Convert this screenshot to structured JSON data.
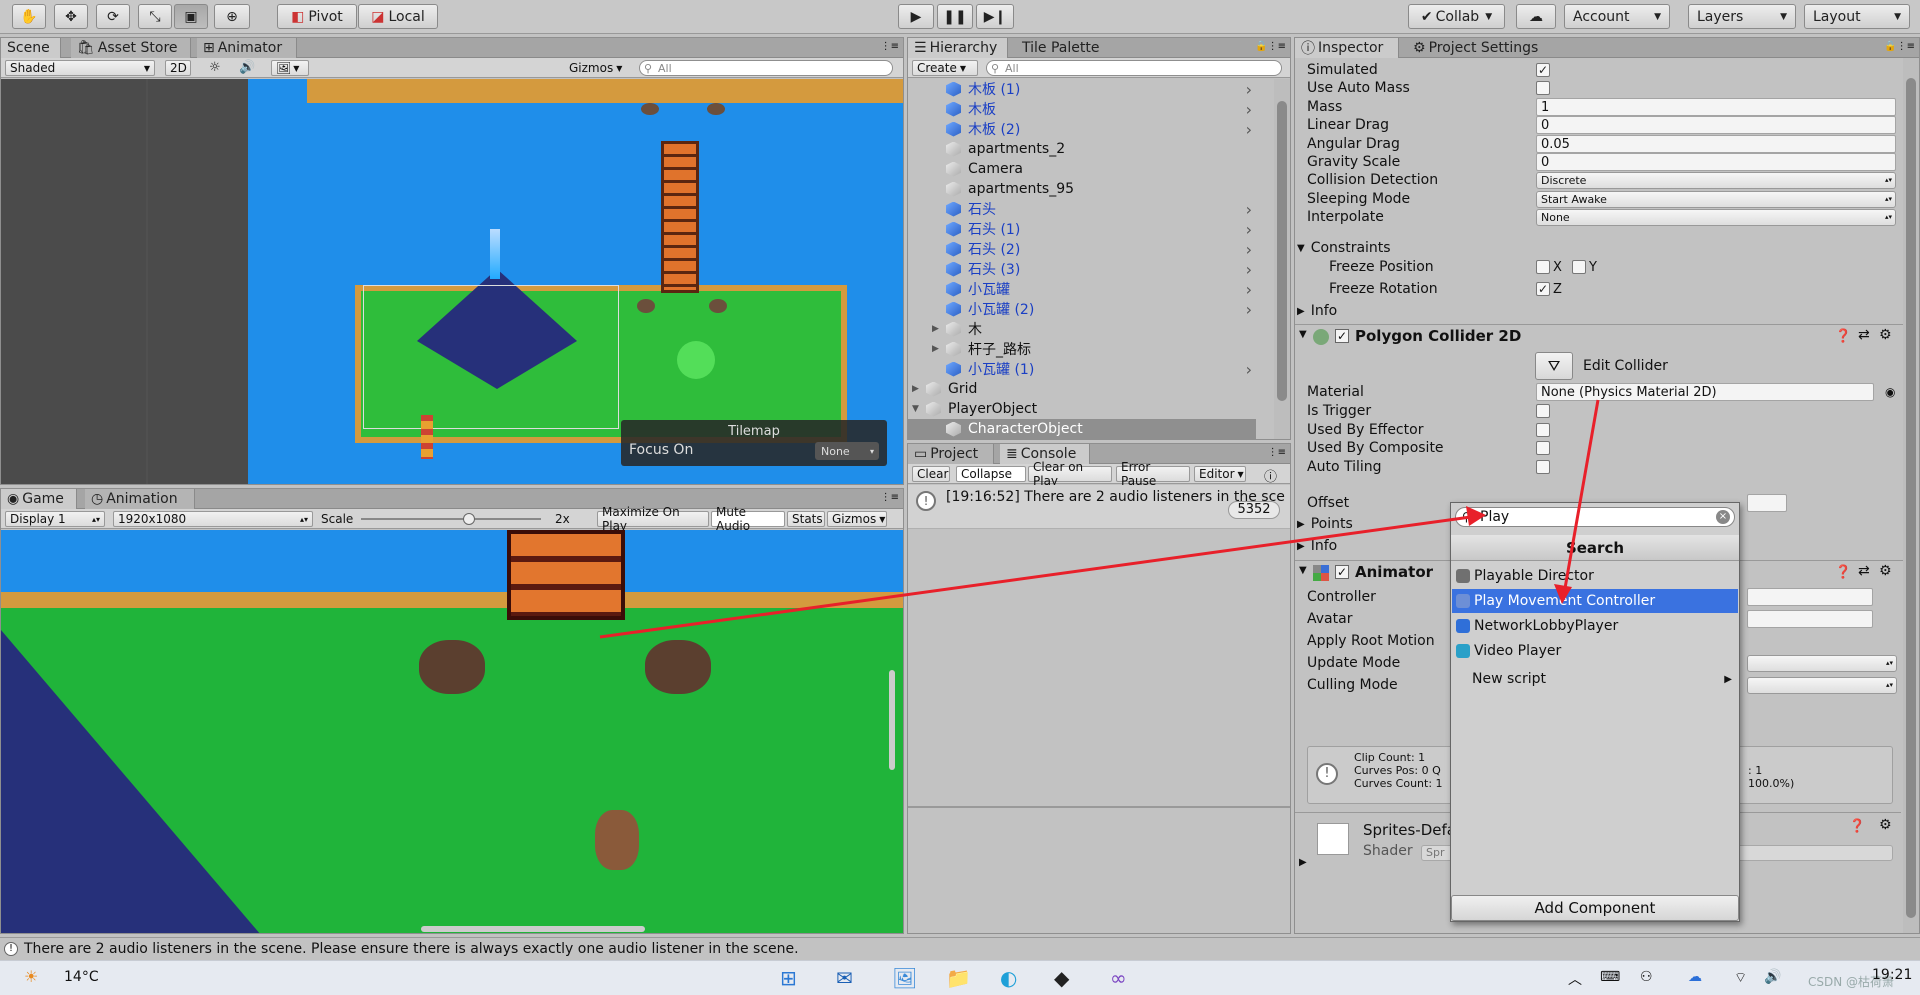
{
  "toolbar": {
    "pivot": "Pivot",
    "local": "Local",
    "collab": "Collab",
    "account": "Account",
    "layers": "Layers",
    "layout": "Layout"
  },
  "scene": {
    "tabs": [
      "Scene",
      "Asset Store",
      "Animator"
    ],
    "shading": "Shaded",
    "mode_2d": "2D",
    "gizmos": "Gizmos",
    "search_placeholder": "All",
    "tilemap_title": "Tilemap",
    "focus_label": "Focus On",
    "focus_value": "None"
  },
  "game": {
    "tabs": [
      "Game",
      "Animation"
    ],
    "display": "Display 1",
    "resolution": "1920x1080",
    "scale_label": "Scale",
    "scale_value": "2x",
    "scale_level": 0.6,
    "buttons": [
      "Maximize On Play",
      "Mute Audio",
      "Stats",
      "Gizmos"
    ]
  },
  "hierarchy": {
    "tabs": [
      "Hierarchy",
      "Tile Palette"
    ],
    "create": "Create",
    "search_placeholder": "All",
    "items": [
      {
        "name": "木板 (1)",
        "prefab": true,
        "indent": 2,
        "arrow": true
      },
      {
        "name": "木板",
        "prefab": true,
        "indent": 2,
        "arrow": true
      },
      {
        "name": "木板 (2)",
        "prefab": true,
        "indent": 2,
        "arrow": true
      },
      {
        "name": "apartments_2",
        "prefab": false,
        "indent": 2,
        "arrow": false
      },
      {
        "name": "Camera",
        "prefab": false,
        "indent": 2,
        "arrow": false
      },
      {
        "name": "apartments_95",
        "prefab": false,
        "indent": 2,
        "arrow": false
      },
      {
        "name": "石头",
        "prefab": true,
        "indent": 2,
        "arrow": true
      },
      {
        "name": "石头 (1)",
        "prefab": true,
        "indent": 2,
        "arrow": true
      },
      {
        "name": "石头 (2)",
        "prefab": true,
        "indent": 2,
        "arrow": true
      },
      {
        "name": "石头 (3)",
        "prefab": true,
        "indent": 2,
        "arrow": true
      },
      {
        "name": "小瓦罐",
        "prefab": true,
        "indent": 2,
        "arrow": true
      },
      {
        "name": "小瓦罐 (2)",
        "prefab": true,
        "indent": 2,
        "arrow": true
      },
      {
        "name": "木",
        "prefab": false,
        "indent": 2,
        "arrow": false,
        "fold": "▶"
      },
      {
        "name": "杆子_路标",
        "prefab": false,
        "indent": 2,
        "arrow": false,
        "fold": "▶"
      },
      {
        "name": "小瓦罐 (1)",
        "prefab": true,
        "indent": 2,
        "arrow": true
      },
      {
        "name": "Grid",
        "prefab": false,
        "indent": 1,
        "arrow": false,
        "fold": "▶"
      },
      {
        "name": "PlayerObject",
        "prefab": false,
        "indent": 1,
        "arrow": false,
        "fold": "▼"
      },
      {
        "name": "CharacterObject",
        "prefab": false,
        "indent": 2,
        "arrow": false,
        "selected": true
      }
    ]
  },
  "project": {
    "tabs": [
      "Project",
      "Console"
    ],
    "buttons": [
      "Clear",
      "Collapse",
      "Clear on Play",
      "Error Pause",
      "Editor"
    ],
    "log": "[19:16:52] There are 2 audio listeners in the sce",
    "count": "5352"
  },
  "inspector": {
    "tabs": [
      "Inspector",
      "Project Settings"
    ],
    "rigidbody": [
      {
        "label": "Simulated",
        "type": "check",
        "value": "✓"
      },
      {
        "label": "Use Auto Mass",
        "type": "check",
        "value": ""
      },
      {
        "label": "Mass",
        "type": "field",
        "value": "1"
      },
      {
        "label": "Linear Drag",
        "type": "field",
        "value": "0"
      },
      {
        "label": "Angular Drag",
        "type": "field",
        "value": "0.05"
      },
      {
        "label": "Gravity Scale",
        "type": "field",
        "value": "0"
      },
      {
        "label": "Collision Detection",
        "type": "dd",
        "value": "Discrete"
      },
      {
        "label": "Sleeping Mode",
        "type": "dd",
        "value": "Start Awake"
      },
      {
        "label": "Interpolate",
        "type": "dd",
        "value": "None"
      }
    ],
    "constraints": "Constraints",
    "freeze_position": "Freeze Position",
    "freeze_rotation": "Freeze Rotation",
    "x": "X",
    "y": "Y",
    "z": "Z",
    "info": "Info",
    "polygon_title": "Polygon Collider 2D",
    "edit_collider": "Edit Collider",
    "material_label": "Material",
    "material_value": "None (Physics Material 2D)",
    "poly_rows": [
      "Is Trigger",
      "Used By Effector",
      "Used By Composite",
      "Auto Tiling"
    ],
    "offset": "Offset",
    "points": "Points",
    "animator_title": "Animator",
    "animator_rows": [
      "Controller",
      "Avatar",
      "Apply Root Motion",
      "Update Mode",
      "Culling Mode"
    ],
    "clip_info": [
      "Clip Count: 1",
      "Curves Pos: 0 Q",
      "Curves Count: 1"
    ],
    "clip_info_right": [
      ": 1",
      "100.0%)"
    ],
    "sprite_title": "Sprites-Defa",
    "shader_label": "Shader",
    "shader_value": "Spr",
    "add_component": "Add Component"
  },
  "popup": {
    "query": "Play",
    "header": "Search",
    "items": [
      {
        "label": "Playable Director",
        "selected": false,
        "icon": "playable-director-icon",
        "color": "#707070"
      },
      {
        "label": "Play Movement Controller",
        "selected": true,
        "icon": "script-icon",
        "color": "#6d8fd6"
      },
      {
        "label": "NetworkLobbyPlayer",
        "selected": false,
        "icon": "network-icon",
        "color": "#2f6fd8"
      },
      {
        "label": "Video Player",
        "selected": false,
        "icon": "video-icon",
        "color": "#2aa0c8"
      }
    ],
    "new_script": "New script"
  },
  "status": "There are 2 audio listeners in the scene. Please ensure there is always exactly one audio listener in the scene.",
  "taskbar": {
    "temperature": "14°C",
    "time": "19:21",
    "watermark": "CSDN @枯荷萧"
  }
}
